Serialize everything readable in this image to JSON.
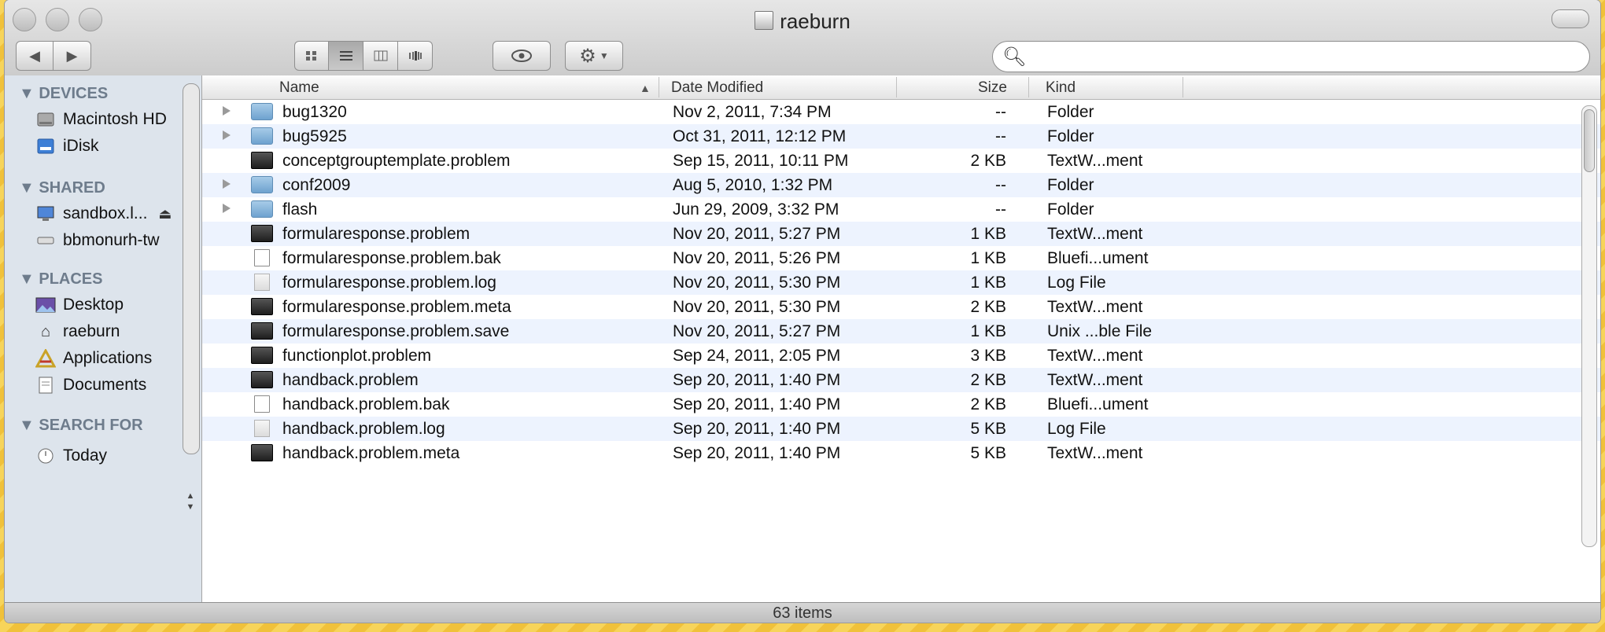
{
  "window": {
    "title": "raeburn",
    "status": "63 items"
  },
  "toolbar": {
    "back_icon": "◀",
    "forward_icon": "▶",
    "views": [
      "icon-view",
      "list-view",
      "column-view",
      "coverflow-view"
    ],
    "active_view": "list-view",
    "search_placeholder": ""
  },
  "sidebar": {
    "sections": [
      {
        "label": "▼ DEVICES",
        "items": [
          {
            "label": "Macintosh HD",
            "icon": "hard-drive-icon"
          },
          {
            "label": "iDisk",
            "icon": "idisk-icon"
          }
        ]
      },
      {
        "label": "▼ SHARED",
        "items": [
          {
            "label": "sandbox.l...",
            "icon": "network-computer-icon"
          },
          {
            "label": "bbmonurh-tw",
            "icon": "network-drive-icon"
          }
        ]
      },
      {
        "label": "▼ PLACES",
        "items": [
          {
            "label": "Desktop",
            "icon": "desktop-icon"
          },
          {
            "label": "raeburn",
            "icon": "home-icon"
          },
          {
            "label": "Applications",
            "icon": "applications-icon"
          },
          {
            "label": "Documents",
            "icon": "documents-icon"
          }
        ]
      },
      {
        "label": "▼ SEARCH FOR",
        "items": [
          {
            "label": "Today",
            "icon": "clock-icon"
          }
        ]
      }
    ]
  },
  "columns": {
    "name": "Name",
    "date": "Date Modified",
    "size": "Size",
    "kind": "Kind"
  },
  "files": [
    {
      "name": "bug1320",
      "date": "Nov 2, 2011, 7:34 PM",
      "size": "--",
      "kind": "Folder",
      "type": "folder"
    },
    {
      "name": "bug5925",
      "date": "Oct 31, 2011, 12:12 PM",
      "size": "--",
      "kind": "Folder",
      "type": "folder"
    },
    {
      "name": "conceptgrouptemplate.problem",
      "date": "Sep 15, 2011, 10:11 PM",
      "size": "2 KB",
      "kind": "TextW...ment",
      "type": "exec"
    },
    {
      "name": "conf2009",
      "date": "Aug 5, 2010, 1:32 PM",
      "size": "--",
      "kind": "Folder",
      "type": "folder"
    },
    {
      "name": "flash",
      "date": "Jun 29, 2009, 3:32 PM",
      "size": "--",
      "kind": "Folder",
      "type": "folder"
    },
    {
      "name": "formularesponse.problem",
      "date": "Nov 20, 2011, 5:27 PM",
      "size": "1 KB",
      "kind": "TextW...ment",
      "type": "exec"
    },
    {
      "name": "formularesponse.problem.bak",
      "date": "Nov 20, 2011, 5:26 PM",
      "size": "1 KB",
      "kind": "Bluefi...ument",
      "type": "doc"
    },
    {
      "name": "formularesponse.problem.log",
      "date": "Nov 20, 2011, 5:30 PM",
      "size": "1 KB",
      "kind": "Log File",
      "type": "log"
    },
    {
      "name": "formularesponse.problem.meta",
      "date": "Nov 20, 2011, 5:30 PM",
      "size": "2 KB",
      "kind": "TextW...ment",
      "type": "exec"
    },
    {
      "name": "formularesponse.problem.save",
      "date": "Nov 20, 2011, 5:27 PM",
      "size": "1 KB",
      "kind": "Unix ...ble File",
      "type": "exec"
    },
    {
      "name": "functionplot.problem",
      "date": "Sep 24, 2011, 2:05 PM",
      "size": "3 KB",
      "kind": "TextW...ment",
      "type": "exec"
    },
    {
      "name": "handback.problem",
      "date": "Sep 20, 2011, 1:40 PM",
      "size": "2 KB",
      "kind": "TextW...ment",
      "type": "exec"
    },
    {
      "name": "handback.problem.bak",
      "date": "Sep 20, 2011, 1:40 PM",
      "size": "2 KB",
      "kind": "Bluefi...ument",
      "type": "doc"
    },
    {
      "name": "handback.problem.log",
      "date": "Sep 20, 2011, 1:40 PM",
      "size": "5 KB",
      "kind": "Log File",
      "type": "log"
    },
    {
      "name": "handback.problem.meta",
      "date": "Sep 20, 2011, 1:40 PM",
      "size": "5 KB",
      "kind": "TextW...ment",
      "type": "exec"
    }
  ]
}
